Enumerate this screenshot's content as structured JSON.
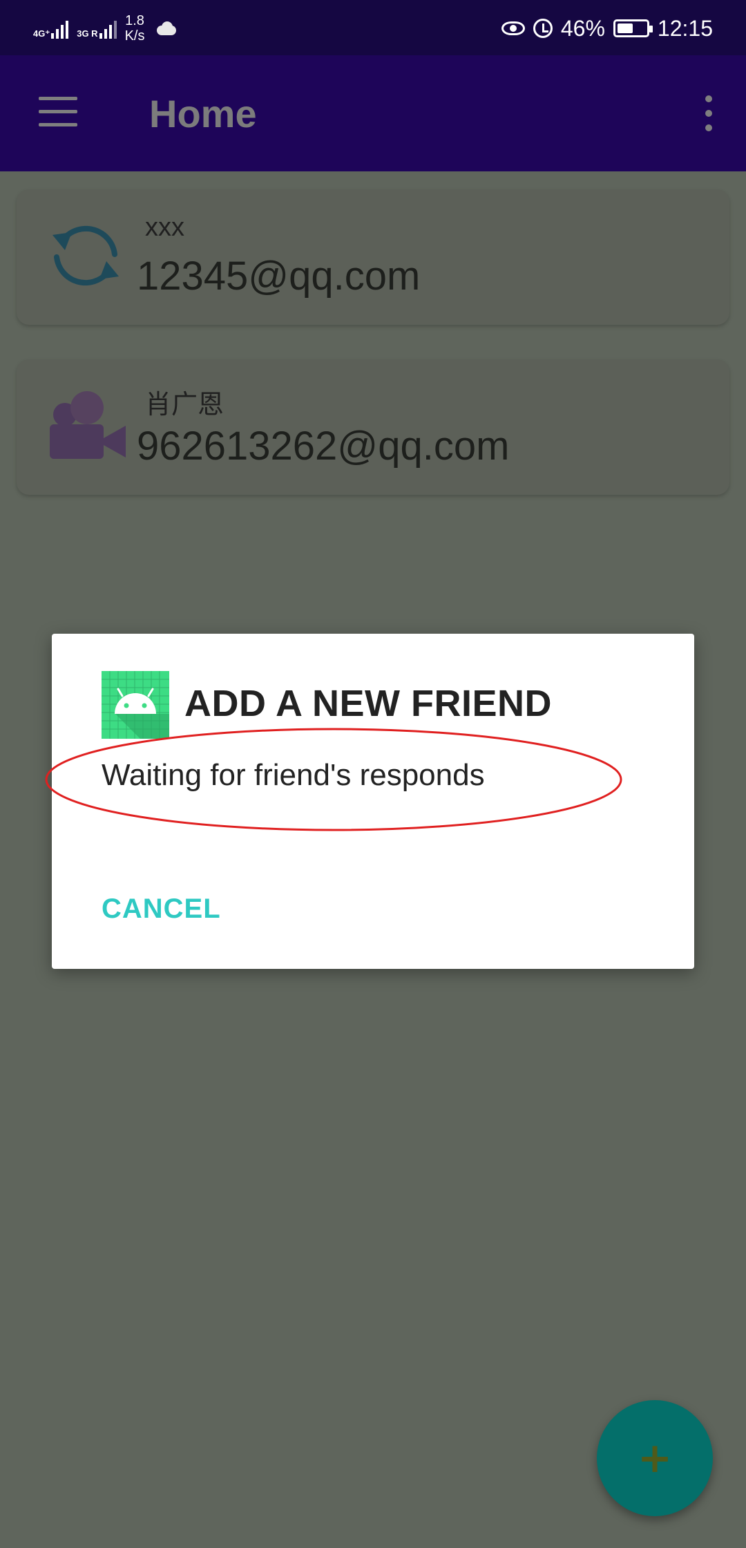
{
  "status_bar": {
    "network1": "4G⁺",
    "network2": "3G R",
    "speed_value": "1.8",
    "speed_unit": "K/s",
    "battery_percent": "46%",
    "time": "12:15"
  },
  "app_bar": {
    "title": "Home"
  },
  "contacts": [
    {
      "name": "xxx",
      "email": "12345@qq.com",
      "icon": "sync-icon"
    },
    {
      "name": "肖广恩",
      "email": "962613262@qq.com",
      "icon": "video-call-icon"
    }
  ],
  "dialog": {
    "title": "ADD A NEW FRIEND",
    "message": "Waiting for friend's responds",
    "cancel_label": "CANCEL",
    "icon": "android-app-icon",
    "annotation_color": "#e02020"
  },
  "fab": {
    "label": "+",
    "color": "#046f6a"
  },
  "colors": {
    "status_bar": "#150742",
    "app_bar": "#1e0559",
    "scrim_bg": "#5f655c",
    "accent": "#2ec9c2"
  }
}
